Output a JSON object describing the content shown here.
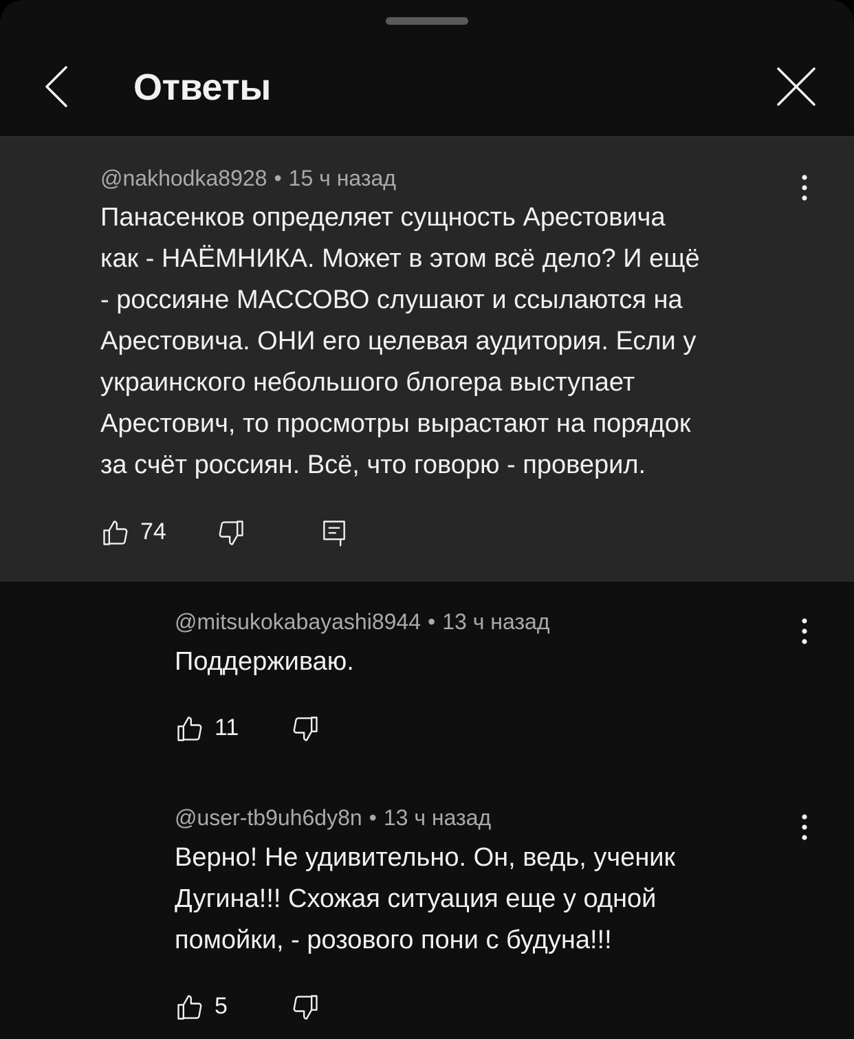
{
  "header": {
    "title": "Ответы"
  },
  "main_comment": {
    "author": "@nakhodka8928",
    "time": "15 ч назад",
    "lines": [
      "Панасенков определяет сущность Арестовича",
      "как - НАЁМНИКА. Может в этом всё дело? И ещё",
      "- россияне МАССОВО слушают  и ссылаются на",
      "Арестовича. ОНИ его целевая аудитория. Если у",
      "украинского небольшого блогера выступает",
      "Арестович, то просмотры вырастают на порядок",
      "за счёт россиян. Всё, что говорю - проверил."
    ],
    "likes": "74"
  },
  "replies": [
    {
      "author": "@mitsukokabayashi8944",
      "time": "13 ч назад",
      "lines": [
        "Поддерживаю."
      ],
      "likes": "11"
    },
    {
      "author": "@user-tb9uh6dy8n",
      "time": "13 ч назад",
      "lines": [
        "Верно! Не удивительно. Он, ведь, ученик",
        "Дугина!!! Схожая ситуация еще у одной",
        "помойки, - розового пони с будуна!!!"
      ],
      "likes": "5"
    }
  ],
  "separator": "•",
  "colors": {
    "background": "#0f0f0f",
    "highlight": "#272727",
    "text": "#f1f1f1",
    "meta": "#aaaaaa"
  }
}
